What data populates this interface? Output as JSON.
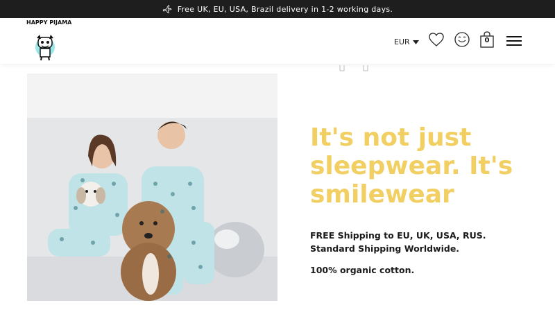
{
  "announcement": {
    "text": "Free UK, EU, USA, Brazil delivery in 1-2 working days.",
    "icon": "airplane-icon"
  },
  "header": {
    "logo_text": "HAPPY PIJAMA",
    "currency": "EUR",
    "bag_count": "0",
    "icons": [
      "heart-icon",
      "smiley-icon",
      "shopping-bag-icon",
      "hamburger-menu-icon"
    ]
  },
  "hero": {
    "headline": "It's not just sleepwear. It's smilewear",
    "shipping": "FREE Shipping to EU, UK, USA, RUS. Standard Shipping Worldwide.",
    "material": "100% organic cotton.",
    "photo_alt": "Couple in matching pajamas with dogs"
  },
  "colors": {
    "accent": "#f2cf63",
    "topbar": "#1f1e1f"
  }
}
